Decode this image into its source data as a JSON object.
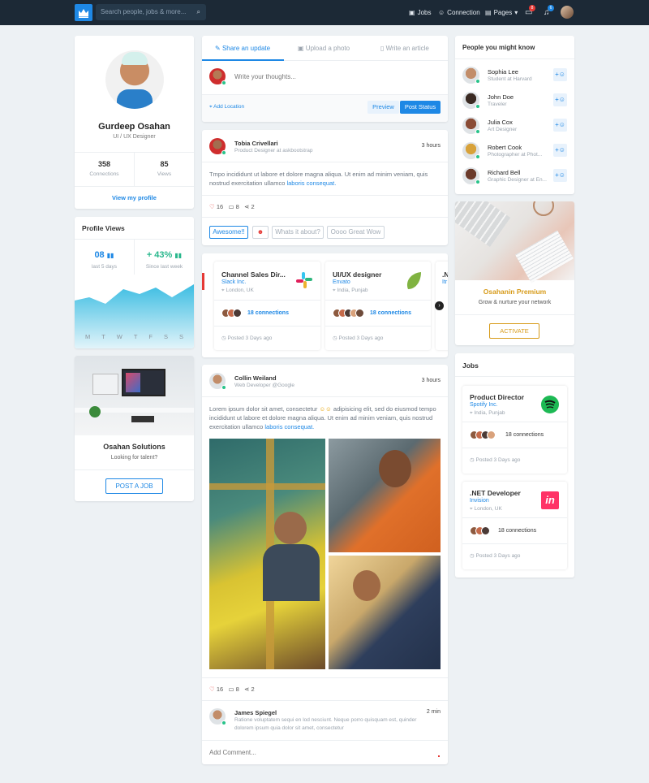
{
  "nav": {
    "search_placeholder": "Search people, jobs & more...",
    "jobs": "Jobs",
    "connection": "Connection",
    "pages": "Pages",
    "msg_badge": "8",
    "notif_badge": "6"
  },
  "profile": {
    "name": "Gurdeep Osahan",
    "role": "UI / UX Designer",
    "connections_count": "358",
    "connections_label": "Connections",
    "views_count": "85",
    "views_label": "Views",
    "view_link": "View my profile"
  },
  "profile_views": {
    "title": "Profile Views",
    "stat1": "08",
    "stat1_label": "last 5 days",
    "stat2": "+ 43%",
    "stat2_label": "Since last week",
    "days": [
      "M",
      "T",
      "W",
      "T",
      "F",
      "S",
      "S"
    ]
  },
  "company": {
    "name": "Osahan Solutions",
    "sub": "Looking for talent?",
    "button": "POST A JOB"
  },
  "composer": {
    "tab1": "Share an update",
    "tab2": "Upload a photo",
    "tab3": "Write an article",
    "placeholder": "Write your thoughts...",
    "location": "Add Location",
    "preview": "Preview",
    "post": "Post Status"
  },
  "post1": {
    "name": "Tobia Crivellari",
    "sub": "Product Designer at askbootstrap",
    "time": "3 hours",
    "text1": "Tmpo incididunt ut labore et dolore magna aliqua. Ut enim ad minim veniam, quis",
    "text2": "nostrud exercitation ullamco ",
    "link": "laboris consequat.",
    "likes": "16",
    "comments": "8",
    "shares": "2",
    "tag1": "Awesome!!",
    "tag3": "Whats it about?",
    "tag4": "Oooo Great Wow"
  },
  "jobs_carousel": [
    {
      "title": "Channel Sales Dir...",
      "company": "Slack Inc.",
      "location": "London, UK",
      "connections": "18 connections",
      "posted": "Posted 3 Days ago"
    },
    {
      "title": "UI/UX designer",
      "company": "Envato",
      "location": "India, Punjab",
      "connections": "18 connections",
      "posted": "Posted 3 Days ago"
    },
    {
      "title": ".N",
      "company": "Itr"
    }
  ],
  "post2": {
    "name": "Collin Weiland",
    "sub": "Web Developer @Google",
    "time": "3 hours",
    "line1a": "Lorem ipsum dolor sit amet, consectetur ",
    "line1b": " adipisicing elit, sed do eiusmod tempo",
    "line2": "incididunt ut labore et dolore magna aliqua. Ut enim ad minim veniam, quis nostrud",
    "line3": "exercitation ullamco ",
    "link": "laboris consequat.",
    "likes": "16",
    "comments": "8",
    "shares": "2",
    "comment": {
      "name": "James Spiegel",
      "time": "2 min",
      "text1": "Ratione voluptatem sequi en lod nesciunt. Neque porro quisquam est, quinder",
      "text2": "dolorem ipsum quia dolor sit amet, consectetur"
    },
    "add_comment": "Add Comment..."
  },
  "people": {
    "title": "People you might know",
    "items": [
      {
        "name": "Sophia Lee",
        "sub": "Student at Harvard"
      },
      {
        "name": "John Doe",
        "sub": "Traveler"
      },
      {
        "name": "Julia Cox",
        "sub": "Art Designer"
      },
      {
        "name": "Robert Cook",
        "sub": "Photographer at Phot..."
      },
      {
        "name": "Richard Bell",
        "sub": "Graphic Designer at En..."
      }
    ]
  },
  "premium": {
    "title": "Osahanin Premium",
    "sub": "Grow & nurture your network",
    "button": "ACTIVATE"
  },
  "jobs": {
    "title": "Jobs",
    "items": [
      {
        "title": "Product Director",
        "company": "Spotify Inc.",
        "location": "India, Punjab",
        "connections": "18 connections",
        "posted": "Posted 3 Days ago"
      },
      {
        "title": ".NET Developer",
        "company": "Invision",
        "location": "London, UK",
        "connections": "18 connections",
        "posted": "Posted 3 Days ago"
      }
    ]
  }
}
